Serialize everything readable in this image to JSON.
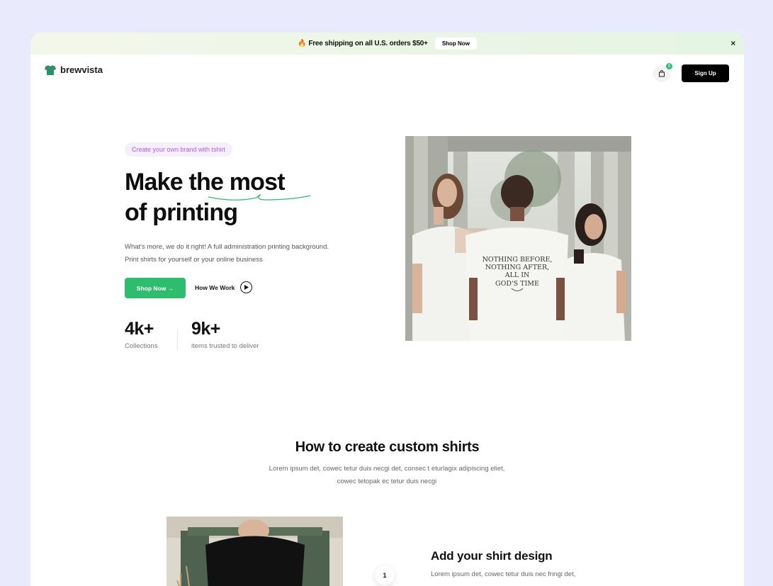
{
  "promo": {
    "fire_icon": "fire-icon",
    "text": "Free shipping on all U.S. orders $50+",
    "button": "Shop Now",
    "close": "×"
  },
  "nav": {
    "brand": "brewvista",
    "cart_count": "0",
    "signup": "Sign Up"
  },
  "hero": {
    "tag": "Create your own brand with tshirt",
    "title_line1": "Make the most",
    "title_line2": "of printing",
    "desc_line1": "What's more, we do it right! A full administration printing background.",
    "desc_line2": "Print shirts for yourself or your online business",
    "shop_button": "Shop Now →",
    "how_button": "How We Work",
    "stats": [
      {
        "num": "4k+",
        "label": "Collections"
      },
      {
        "num": "9k+",
        "label": "items trusted to deliver"
      }
    ],
    "shirt_print": [
      "NOTHING BEFORE,",
      "NOTHING AFTER,",
      "ALL IN",
      "GOD'S TIME"
    ]
  },
  "how": {
    "title": "How to create custom shirts",
    "desc_line1": "Lorem ipsum det, cowec tetur duis necgi det, consec t eturlagix adipiscing eliet,",
    "desc_line2": "cowec tetopak ec tetur duis necgi"
  },
  "step1": {
    "num": "1",
    "title": "Add your shirt design",
    "desc": "Lorem ipsum det, cowec tetur duis nec fringi det,"
  },
  "colors": {
    "accent_green": "#2ebd6e",
    "tag_purple": "#b05fd6",
    "background": "#e9ebfc"
  }
}
